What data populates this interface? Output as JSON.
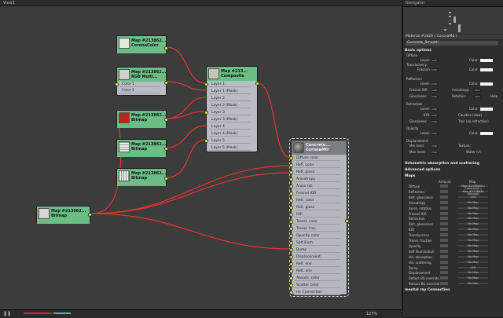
{
  "view": {
    "title": "View1"
  },
  "navigator": {
    "title": "Navigator"
  },
  "material": {
    "title": "Material #1826 ( CoronaMtl )",
    "name": "Concrete_Smooth",
    "sections": {
      "basic": "Basic options",
      "volumetric": "Volumetric absorption and scattering",
      "advanced": "Advanced options",
      "maps": "Maps",
      "mental": "mental ray Connection"
    },
    "basic": {
      "diffuse": "Diffuse",
      "level": "Level:",
      "color": "Color:",
      "translucency": "Translucency",
      "fraction": "Fraction:",
      "reflection": "Reflection",
      "fresnel_ior": "Fresnel IOR:",
      "anisotropy": "Anisotropy:",
      "glossiness": "Glossiness:",
      "rotation": "Rotation:",
      "help": "Help",
      "refraction": "Refraction",
      "ior": "IOR:",
      "caustics": "Caustics (slow)",
      "thin": "Thin (no refraction)",
      "opacity": "Opacity",
      "displacement": "Displacement",
      "min_level": "Min level:",
      "max_level": "Max level:",
      "texture": "Texture:",
      "water_lvl": "Water lvl:"
    },
    "maps_header": {
      "amount": "Amount",
      "map": "Map"
    },
    "map_rows": [
      {
        "name": "Diffuse",
        "amount": "",
        "map": "Map #2138625 ( Composite )"
      },
      {
        "name": "Reflection",
        "amount": "",
        "map": "Map #2138630 (Bitmap)"
      },
      {
        "name": "Refl. glossiness",
        "amount": "",
        "map": "(03)"
      },
      {
        "name": "Anisotropy",
        "amount": "",
        "map": "No Map"
      },
      {
        "name": "Aniso. rotation",
        "amount": "",
        "map": "No Map"
      },
      {
        "name": "Fresnel IOR",
        "amount": "",
        "map": "No Map"
      },
      {
        "name": "Refraction",
        "amount": "",
        "map": "No Map"
      },
      {
        "name": "Refr. glossiness",
        "amount": "",
        "map": "No Map"
      },
      {
        "name": "IOR",
        "amount": "",
        "map": "No Map"
      },
      {
        "name": "Translucency",
        "amount": "",
        "map": "No Map"
      },
      {
        "name": "Transl. fraction",
        "amount": "",
        "map": "No Map"
      },
      {
        "name": "Opacity",
        "amount": "",
        "map": "No Map"
      },
      {
        "name": "Self Illumination",
        "amount": "",
        "map": "No Map"
      },
      {
        "name": "Vol. absorption",
        "amount": "",
        "map": "No Map"
      },
      {
        "name": "Vol. scattering",
        "amount": "",
        "map": "No Map"
      },
      {
        "name": "Bump",
        "amount": "",
        "map": "(03)"
      },
      {
        "name": "Displacement",
        "amount": "",
        "map": "No Map"
      },
      {
        "name": "Reflect BG override",
        "amount": "",
        "map": "No Map"
      },
      {
        "name": "Refract BG override",
        "amount": "",
        "map": "No Map"
      }
    ]
  },
  "nodes": {
    "corona_color": {
      "t1": "Map #213862...",
      "t2": "CoronaColor"
    },
    "rgb_multi": {
      "t1": "Map #213862...",
      "t2": "RGB Multi...",
      "slots": [
        "Color 1",
        "Color 2"
      ]
    },
    "bitmap_red": {
      "t1": "Map #213862...",
      "t2": "Bitmap"
    },
    "bitmap_2": {
      "t1": "Map #213862...",
      "t2": "Bitmap"
    },
    "bitmap_3": {
      "t1": "Map #213862...",
      "t2": "Bitmap"
    },
    "bitmap_left": {
      "t1": "Map #213862...",
      "t2": "Bitmap"
    },
    "composite": {
      "t1": "Map #213...",
      "t2": "Composite",
      "slots": [
        "Layer 1",
        "Layer 1 (Mask)",
        "Layer 2",
        "Layer 2 (Mask)",
        "Layer 3",
        "Layer 3 (Mask)",
        "Layer 4",
        "Layer 4 (Mask)",
        "Layer 5",
        "Layer 5 (Mask)"
      ]
    },
    "concrete": {
      "t1": "Concrete...",
      "t2": "CoronaMtl",
      "slots": [
        "Diffuse color",
        "Refl. color",
        "Refl. gloss",
        "Anisotropy",
        "Aniso rot.",
        "Fresnel IOR",
        "Refr. color",
        "Refr. gloss",
        "IOR",
        "Transl. color",
        "Transl. frac.",
        "Opacity color",
        "Self illum.",
        "Bump",
        "Displacement",
        "Refl. env",
        "Refr. env",
        "Absorb. color",
        "Scatter color",
        "mr Connection"
      ]
    }
  },
  "status": {
    "zoom": "127%"
  },
  "colors": {
    "node_header": "#6bbd86",
    "wire": "#e8332f",
    "socket": "#f3f024",
    "selected_node": "#b8b8b8"
  }
}
